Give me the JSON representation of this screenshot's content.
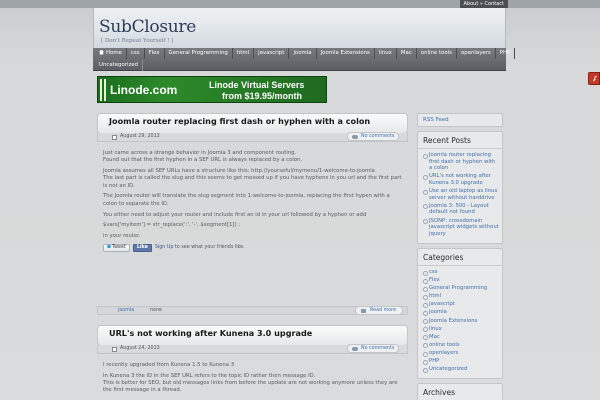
{
  "top_links": {
    "about": "About",
    "separator": " » ",
    "contact": "Contact"
  },
  "header": {
    "title": "SubClosure",
    "tagline": "[ Don't Repeat Yourself ! ]"
  },
  "nav": {
    "row1": [
      "Home",
      "css",
      "Flex",
      "General Programming",
      "html",
      "javascript",
      "joomla",
      "Joomla Extensions",
      "linux",
      "Mac",
      "online tools",
      "openlayers",
      "PHP"
    ],
    "row2": [
      "Uncategorized"
    ]
  },
  "banner": {
    "logo": "Linode.com",
    "line1": "Linode Virtual Servers",
    "line2": "from $19.95/month"
  },
  "posts": [
    {
      "title": "Joomla router replacing first dash or hyphen with a colon",
      "date": "August 29, 2013",
      "comments": "No comments",
      "body": [
        "Just came across a strange behavior in Joomla 3 and component routing.",
        "Found out that the first hyphen in a SEF URL is always replaced by a colon.",
        "Joomla assumes all SEF URLs have a structure like this: http://yourseful/mymenu/1-welcome-to-joomla",
        "The last part is called the slug and this seems to get messed up if you have hyphens in you url and the first part is not an ID.",
        "The Joomla router will translate the slug segment into 1:welcome-to-joomla, replacing the first hypen with a colon to separate the ID.",
        "You either need to adjust your router and include first an id in your url followed by a hyphen or add",
        "$vars['myitem'] = str_replace(':', '-', $segment[1]) ;",
        "in your router."
      ],
      "tweet": "Tweet",
      "like": "Like",
      "signup_text": "Sign Up",
      "signup_suffix": " to see what your friends like.",
      "category": "joomla",
      "tags": "none",
      "read_more": "Read more"
    },
    {
      "title": "URL's not working after Kunena 3.0 upgrade",
      "date": "August 24, 2013",
      "comments": "No comments",
      "body": [
        "I recently upgraded from Kunena 1.5 to Kunena 3",
        "In Kunena 3 the ID in the SEF URL refers to the topic ID rather then message ID.",
        "This is better for SEO, but old messages links from before the update are not working anymore unless they are the first message in a thread."
      ]
    }
  ],
  "sidebar": {
    "rss": "RSS Feed",
    "recent_title": "Recent Posts",
    "recent": [
      "Joomla router replacing first dash or hyphen with a colon",
      "URL's not working after Kunena 3.0 upgrade",
      "Use an old laptop as linux server without harddrive",
      "Joomla 3: 500 - Layout default not found",
      "JSONP: crossdomain javascript widgets without jquery"
    ],
    "categories_title": "Categories",
    "categories": [
      "css",
      "Flex",
      "General Programming",
      "html",
      "javascript",
      "joomla",
      "Joomla Extensions",
      "linux",
      "Mac",
      "online tools",
      "openlayers",
      "PHP",
      "Uncategorized"
    ],
    "archives_title": "Archives"
  }
}
